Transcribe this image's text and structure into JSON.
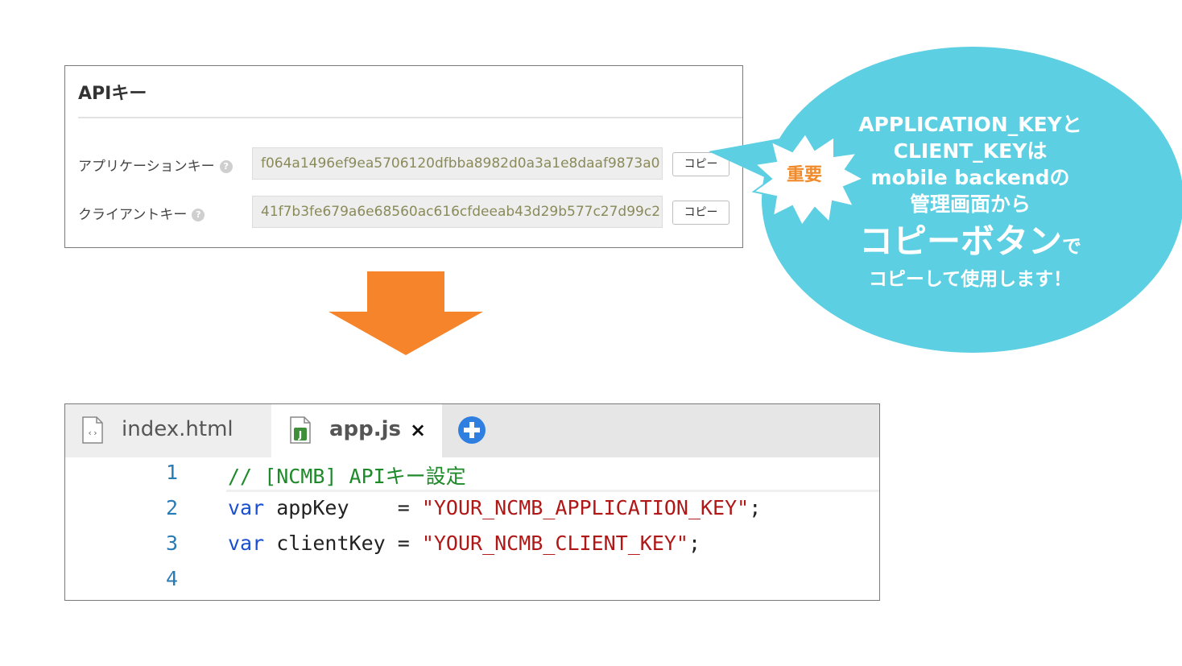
{
  "api_panel": {
    "title": "APIキー",
    "rows": [
      {
        "label": "アプリケーションキー",
        "help": "?",
        "value": "f064a1496ef9ea5706120dfbba8982d0a3a1e8daaf9873a0",
        "copy_label": "コピー"
      },
      {
        "label": "クライアントキー",
        "help": "?",
        "value": "41f7b3fe679a6e68560ac616cfdeeab43d29b577c27d99c2",
        "copy_label": "コピー"
      }
    ]
  },
  "callout": {
    "badge": "重要",
    "line1": "APPLICATION_KEYと",
    "line2": "CLIENT_KEYは",
    "line3": "mobile backendの",
    "line4": "管理画面から",
    "big": "コピーボタン",
    "big_suffix": "で",
    "line5": "コピーして使用します！",
    "colors": {
      "bubble": "#5ccfe3",
      "badge_text": "#f08a2a"
    }
  },
  "arrow": {
    "color": "#f5842a",
    "icon": "down-arrow-icon"
  },
  "editor": {
    "tabs": [
      {
        "label": "index.html",
        "icon": "html-file-icon",
        "active": false
      },
      {
        "label": "app.js",
        "icon": "js-file-icon",
        "active": true,
        "close": "×"
      }
    ],
    "add_tab_icon": "plus-circle-icon",
    "lines": [
      {
        "num": "1",
        "comment": "// [NCMB] APIキー設定"
      },
      {
        "num": "2",
        "kw": "var",
        "text": " appKey    = ",
        "str": "\"YOUR_NCMB_APPLICATION_KEY\"",
        "end": ";"
      },
      {
        "num": "3",
        "kw": "var",
        "text": " clientKey = ",
        "str": "\"YOUR_NCMB_CLIENT_KEY\"",
        "end": ";"
      },
      {
        "num": "4"
      }
    ]
  }
}
